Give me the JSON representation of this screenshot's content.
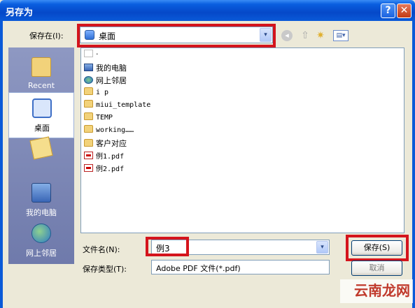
{
  "window": {
    "title": "另存为",
    "help_label": "?",
    "close_label": "✕"
  },
  "save_in": {
    "label": "保存在(I):",
    "value": "桌面",
    "dropdown_glyph": "▾"
  },
  "toolbar": {
    "back_glyph": "◂",
    "up_glyph": "⇧",
    "new_folder_glyph": "✷",
    "view_glyph": "▤▾"
  },
  "places": [
    {
      "label": "Recent"
    },
    {
      "label": "桌面"
    },
    {
      "label": ""
    },
    {
      "label": "我的电脑"
    },
    {
      "label": "网上邻居"
    }
  ],
  "files": [
    {
      "name": "·",
      "icon": "blank-icon"
    },
    {
      "name": "我的电脑",
      "icon": "computer-icon"
    },
    {
      "name": "网上邻居",
      "icon": "network-icon"
    },
    {
      "name": "i p",
      "icon": "folder-icon"
    },
    {
      "name": "miui_template",
      "icon": "folder-icon"
    },
    {
      "name": "TEMP",
      "icon": "folder-icon"
    },
    {
      "name": "working……",
      "icon": "folder-icon"
    },
    {
      "name": "客户对应",
      "icon": "folder-icon"
    },
    {
      "name": "例1.pdf",
      "icon": "pdf-icon"
    },
    {
      "name": "例2.pdf",
      "icon": "pdf-icon"
    }
  ],
  "file_name": {
    "label": "文件名(N):",
    "value": "例3"
  },
  "file_type": {
    "label": "保存类型(T):",
    "value": "Adobe PDF 文件(*.pdf)"
  },
  "buttons": {
    "save_label": "保存(S)",
    "cancel_label": "取消"
  },
  "watermark": {
    "text": "云南龙网"
  },
  "colors": {
    "titlebar": "#0548c8",
    "highlight_border": "#d4141c",
    "places_bar": "#7b86b4",
    "dialog_bg": "#ece9d8"
  }
}
